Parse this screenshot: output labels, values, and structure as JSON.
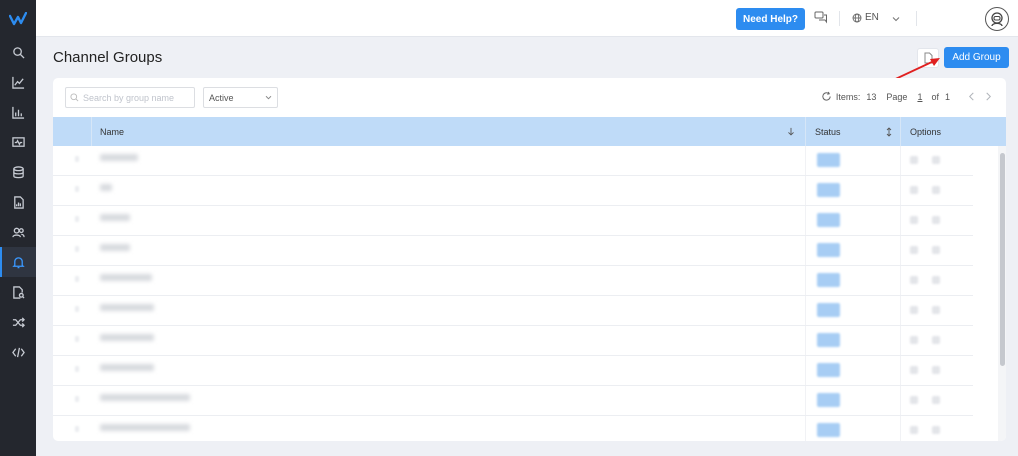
{
  "header": {
    "help_label": "Need Help?",
    "language": "EN"
  },
  "sidebar": {
    "items": [
      {
        "icon": "search-icon"
      },
      {
        "icon": "trend-chart-icon"
      },
      {
        "icon": "bar-chart-icon"
      },
      {
        "icon": "monitor-icon"
      },
      {
        "icon": "database-icon"
      },
      {
        "icon": "report-file-icon"
      },
      {
        "icon": "users-icon"
      },
      {
        "icon": "bell-icon",
        "active": true
      },
      {
        "icon": "document-search-icon"
      },
      {
        "icon": "shuffle-icon"
      },
      {
        "icon": "code-icon"
      }
    ]
  },
  "page": {
    "title": "Channel Groups",
    "add_label": "Add Group"
  },
  "toolbar": {
    "search_placeholder": "Search by group name",
    "status_filter": "Active",
    "items_label": "Items:",
    "items_count": "13",
    "page_label": "Page",
    "current_page": "1",
    "of_label": "of",
    "total_pages": "1"
  },
  "table": {
    "columns": {
      "name": "Name",
      "status": "Status",
      "options": "Options"
    }
  },
  "colors": {
    "accent": "#2d8cf0",
    "sidebar_bg": "#24272e",
    "header_row": "#bfdbf8",
    "annotation_arrow": "#e02020"
  }
}
